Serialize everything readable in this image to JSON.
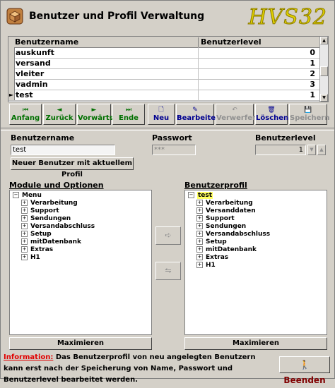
{
  "window": {
    "title": "Benutzer und Profil Verwaltung",
    "brand": "HVS32"
  },
  "grid": {
    "columns": [
      "Benutzername",
      "Benutzerlevel"
    ],
    "rows": [
      {
        "name": "auskunft",
        "level": "0"
      },
      {
        "name": "versand",
        "level": "1"
      },
      {
        "name": "vleiter",
        "level": "2"
      },
      {
        "name": "vadmin",
        "level": "3"
      },
      {
        "name": "test",
        "level": "1"
      }
    ],
    "current_indicator": "►"
  },
  "nav": {
    "first": {
      "label": "Anfang",
      "icon": "⏮"
    },
    "back": {
      "label": "Zurück",
      "icon": "◄"
    },
    "forward": {
      "label": "Vorwärts",
      "icon": "►"
    },
    "last": {
      "label": "Ende",
      "icon": "⏭"
    },
    "new": {
      "label": "Neu",
      "icon": "🗋"
    },
    "edit": {
      "label": "Bearbeiten",
      "icon": "✎"
    },
    "discard": {
      "label": "Verwerfen",
      "icon": "↶"
    },
    "delete": {
      "label": "Löschen",
      "icon": "🗑"
    },
    "save": {
      "label": "Speichern",
      "icon": "💾"
    }
  },
  "form": {
    "username_label": "Benutzername",
    "username_value": "test",
    "password_label": "Passwort",
    "password_value": "***",
    "level_label": "Benutzerlevel",
    "level_value": "1",
    "new_user_button": "Neuer Benutzer mit aktuellem Profil"
  },
  "modules": {
    "title": "Module und Optionen",
    "root": "Menu",
    "items": [
      "Verarbeitung",
      "Support",
      "Sendungen",
      "Versandabschluss",
      "Setup",
      "mitDatenbank",
      "Extras",
      "H1"
    ],
    "maximize": "Maximieren"
  },
  "profile": {
    "title": "Benutzerprofil",
    "root": "test",
    "items": [
      "Verarbeitung",
      "Versanddaten",
      "Support",
      "Sendungen",
      "Versandabschluss",
      "Setup",
      "mitDatenbank",
      "Extras",
      "H1"
    ],
    "maximize": "Maximieren"
  },
  "move": {
    "add_icon": "➪",
    "remove_icon": "⇋"
  },
  "info": {
    "label": "Information:",
    "text": "Das Benutzerprofil von neu angelegten Benutzern kann erst nach der Speicherung von Name, Passwort und Benutzerlevel bearbeitet werden."
  },
  "quit": {
    "icon": "🚶",
    "label": "Beenden"
  },
  "colors": {
    "nav_green": "#007000",
    "action_blue": "#000090",
    "info_red": "#e00000",
    "brand_yellow": "#e0d000",
    "tree_highlight": "#ffff60"
  }
}
